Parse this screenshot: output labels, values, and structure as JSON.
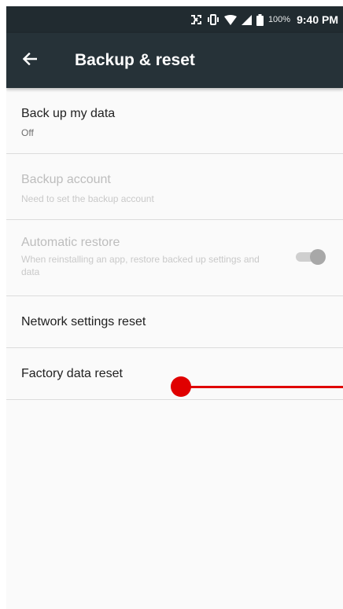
{
  "status_bar": {
    "battery_percent": "100%",
    "time": "9:40 PM",
    "icons": [
      "nfc-icon",
      "vibrate-icon",
      "wifi-icon",
      "signal-icon",
      "battery-icon"
    ]
  },
  "app_bar": {
    "title": "Backup & reset",
    "back_icon": "arrow-back-icon"
  },
  "settings": {
    "backup": {
      "title": "Back up my data",
      "summary": "Off"
    },
    "account": {
      "title": "Backup account",
      "summary": "Need to set the backup account"
    },
    "restore": {
      "title": "Automatic restore",
      "summary": "When reinstalling an app, restore backed up settings and data",
      "toggle_on": true
    },
    "network_reset": {
      "title": "Network settings reset"
    },
    "factory_reset": {
      "title": "Factory data reset"
    }
  },
  "colors": {
    "status_bar": "#212b30",
    "app_bar": "#263238",
    "annotation": "#e00000"
  }
}
